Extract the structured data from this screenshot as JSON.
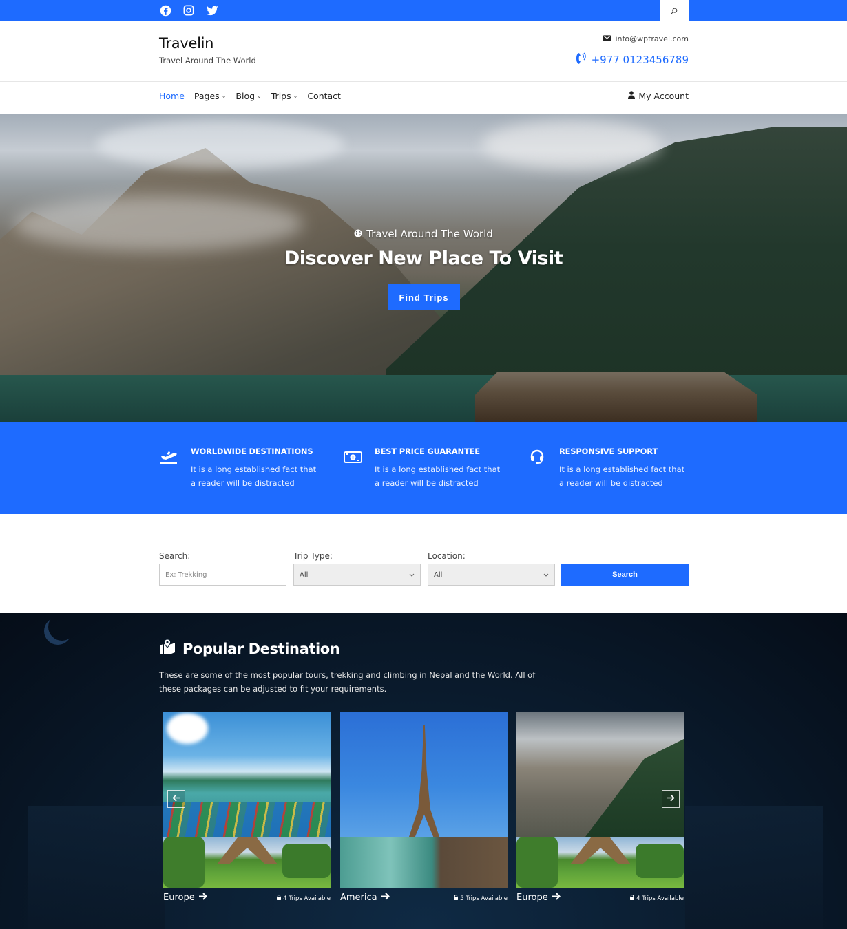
{
  "topbar": {
    "social": [
      {
        "name": "facebook-icon"
      },
      {
        "name": "instagram-icon"
      },
      {
        "name": "twitter-icon"
      }
    ],
    "search_icon": "search-icon",
    "color": "#1e6bff"
  },
  "header": {
    "site_title": "Travelin",
    "tagline": "Travel Around The World",
    "email": "info@wptravel.com",
    "phone": "+977 0123456789"
  },
  "nav": {
    "items": [
      {
        "label": "Home",
        "active": true,
        "has_dropdown": false
      },
      {
        "label": "Pages",
        "active": false,
        "has_dropdown": true
      },
      {
        "label": "Blog",
        "active": false,
        "has_dropdown": true
      },
      {
        "label": "Trips",
        "active": false,
        "has_dropdown": true
      },
      {
        "label": "Contact",
        "active": false,
        "has_dropdown": false
      }
    ],
    "account_label": "My Account"
  },
  "hero": {
    "subtitle": "Travel Around The World",
    "title": "Discover New Place To Visit",
    "button_label": "Find Trips"
  },
  "features": [
    {
      "icon": "plane-departure-icon",
      "title": "WORLDWIDE DESTINATIONS",
      "desc": "It is a long established fact that a reader will be distracted"
    },
    {
      "icon": "money-bill-icon",
      "title": "BEST PRICE GUARANTEE",
      "desc": "It is a long established fact that a reader will be distracted"
    },
    {
      "icon": "headset-icon",
      "title": "RESPONSIVE SUPPORT",
      "desc": "It is a long established fact that a reader will be distracted"
    }
  ],
  "search_form": {
    "search_label": "Search:",
    "search_placeholder": "Ex: Trekking",
    "trip_type_label": "Trip Type:",
    "trip_type_value": "All",
    "location_label": "Location:",
    "location_value": "All",
    "button_label": "Search"
  },
  "popular": {
    "title": "Popular Destination",
    "description": "These are some of the most popular tours, trekking and climbing in Nepal and the World. All of these packages can be adjusted to fit your requirements.",
    "cards": [
      {
        "name": "Europe",
        "trips": "4 Trips Available"
      },
      {
        "name": "America",
        "trips": "5 Trips Available"
      },
      {
        "name": "Europe",
        "trips": "4 Trips Available"
      }
    ]
  }
}
